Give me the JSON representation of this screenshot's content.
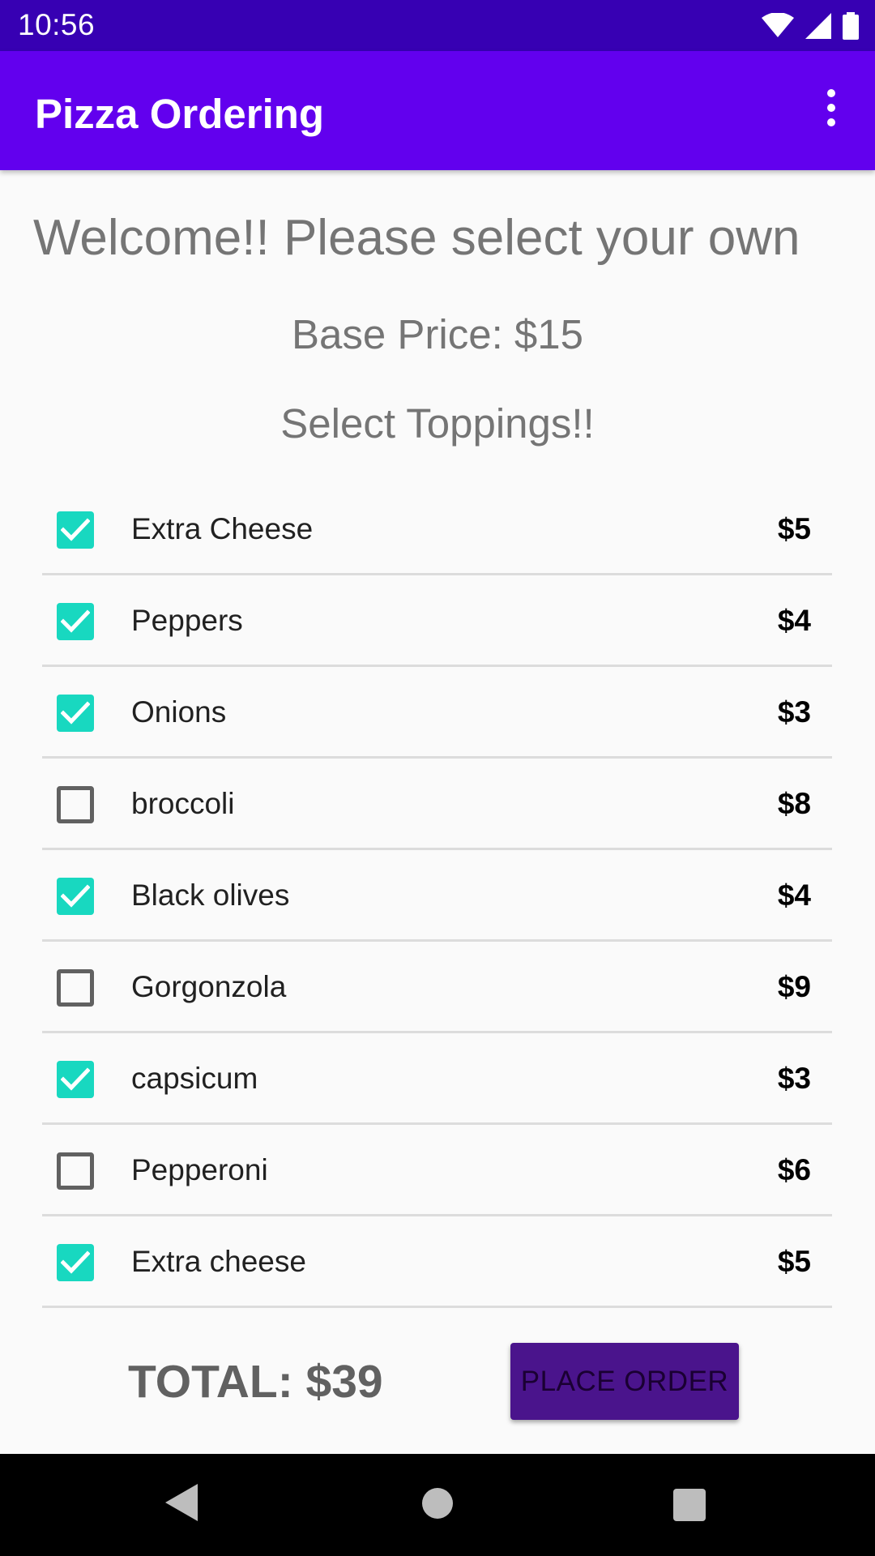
{
  "status_bar": {
    "time": "10:56"
  },
  "app_bar": {
    "title": "Pizza Ordering"
  },
  "main": {
    "welcome_text": "Welcome!! Please select your own",
    "base_price": "Base Price: $15",
    "select_toppings": "Select Toppings!!"
  },
  "toppings": [
    {
      "name": "Extra Cheese",
      "price": "$5",
      "checked": true
    },
    {
      "name": "Peppers",
      "price": "$4",
      "checked": true
    },
    {
      "name": "Onions",
      "price": "$3",
      "checked": true
    },
    {
      "name": "broccoli",
      "price": "$8",
      "checked": false
    },
    {
      "name": "Black olives",
      "price": "$4",
      "checked": true
    },
    {
      "name": "Gorgonzola",
      "price": "$9",
      "checked": false
    },
    {
      "name": "capsicum",
      "price": "$3",
      "checked": true
    },
    {
      "name": "Pepperoni",
      "price": "$6",
      "checked": false
    },
    {
      "name": "Extra cheese",
      "price": "$5",
      "checked": true
    }
  ],
  "footer": {
    "total": "TOTAL: $39",
    "place_order_label": "PLACE ORDER"
  },
  "colors": {
    "status_bar": "#3700b3",
    "app_bar": "#6200ee",
    "checkbox_checked": "#18d8c0",
    "button": "#4a148c"
  }
}
